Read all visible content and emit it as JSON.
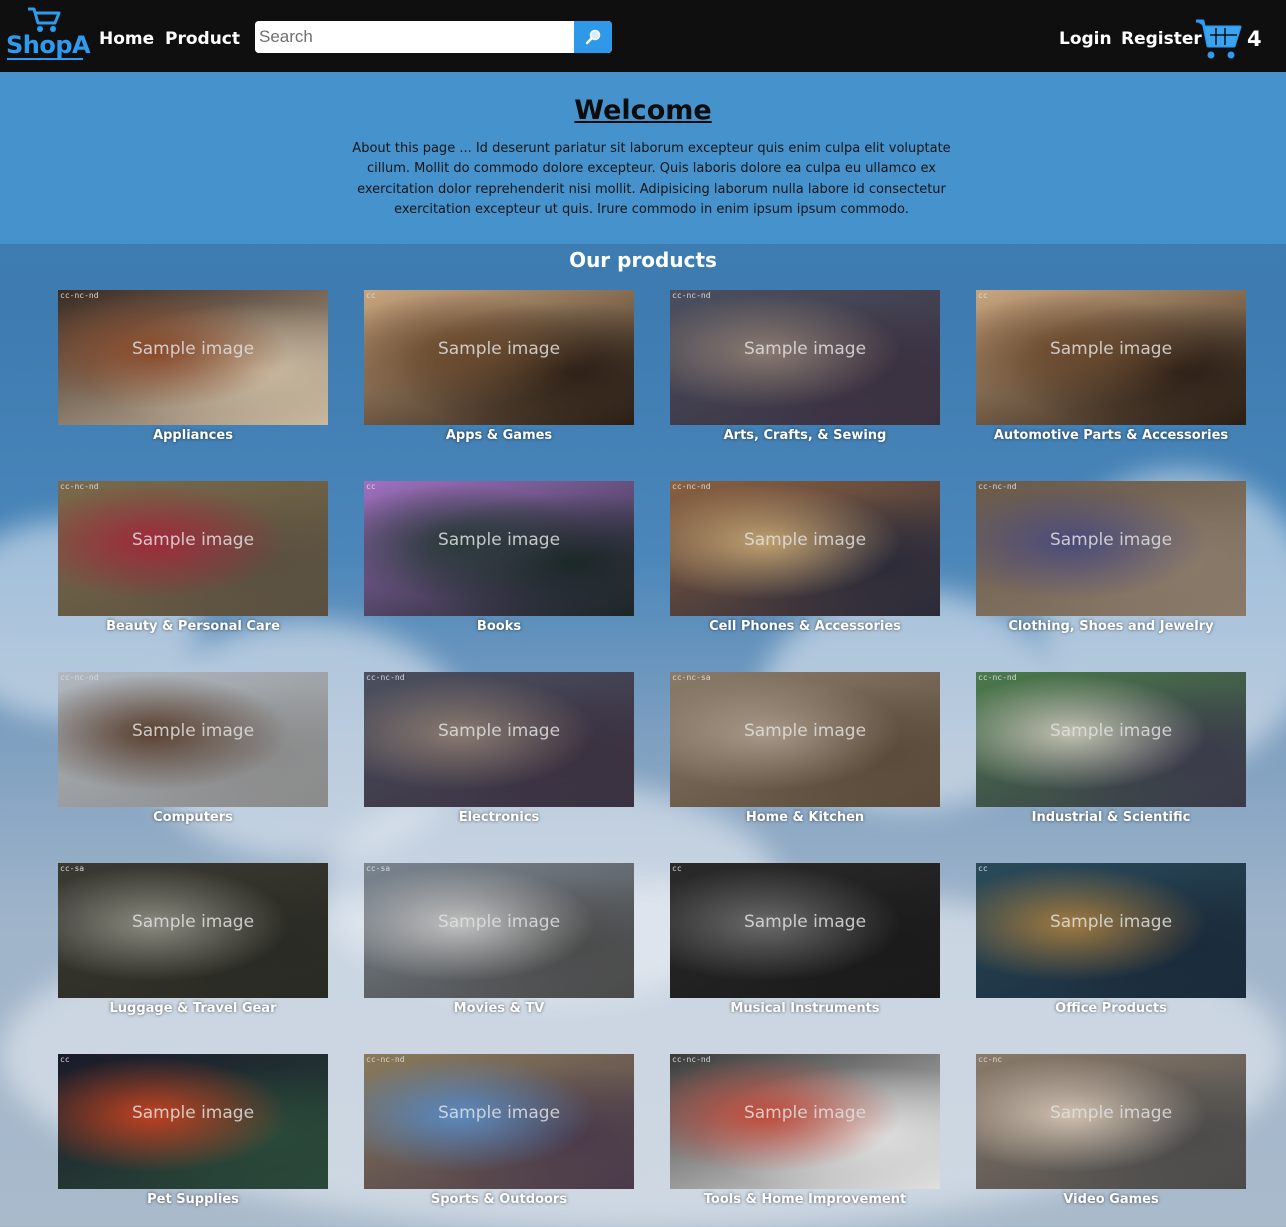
{
  "brand": {
    "name": "ShopA"
  },
  "nav": {
    "home": "Home",
    "product": "Product",
    "login": "Login",
    "register": "Register"
  },
  "search": {
    "placeholder": "Search",
    "value": ""
  },
  "cart": {
    "count": "4"
  },
  "hero": {
    "title": "Welcome",
    "text": "About this page ... Id deserunt pariatur sit laborum excepteur quis enim culpa elit voluptate cillum. Mollit do commodo dolore excepteur. Quis laboris dolore ea culpa eu ullamco ex exercitation dolor reprehenderit nisi mollit. Adipisicing laborum nulla labore id consectetur exercitation excepteur ut quis. Irure commodo in enim ipsum ipsum commodo."
  },
  "products": {
    "title": "Our products",
    "sample_text": "Sample image",
    "items": [
      {
        "label": "Appliances",
        "license": "cc-nc-nd",
        "colors": [
          "#3a2a22",
          "#8a4a2a",
          "#c9b9a0"
        ]
      },
      {
        "label": "Apps & Games",
        "license": "cc",
        "colors": [
          "#c9a680",
          "#6b4a2e",
          "#2a1e15"
        ]
      },
      {
        "label": "Arts, Crafts, & Sewing",
        "license": "cc-nc-nd",
        "colors": [
          "#4a4f5f",
          "#8a7a70",
          "#3a3040"
        ]
      },
      {
        "label": "Automotive Parts & Accessories",
        "license": "cc",
        "colors": [
          "#c9a680",
          "#6b4a2e",
          "#2a1e15"
        ]
      },
      {
        "label": "Beauty & Personal Care",
        "license": "cc-nc-nd",
        "colors": [
          "#7a6a4a",
          "#a02a3a",
          "#5a5040"
        ]
      },
      {
        "label": "Books",
        "license": "cc",
        "colors": [
          "#a070c0",
          "#2a3a3a",
          "#1a2626"
        ]
      },
      {
        "label": "Cell Phones & Accessories",
        "license": "cc-nc-nd",
        "colors": [
          "#8a6040",
          "#c0a070",
          "#2a2a3a"
        ]
      },
      {
        "label": "Clothing, Shoes and Jewelry",
        "license": "cc-nc-nd",
        "colors": [
          "#6a5a4a",
          "#4a4a7a",
          "#8a7a6a"
        ]
      },
      {
        "label": "Computers",
        "license": "cc-nc-nd",
        "colors": [
          "#b0b8c0",
          "#5a4030",
          "#8a8a8a"
        ]
      },
      {
        "label": "Electronics",
        "license": "cc-nc-nd",
        "colors": [
          "#4a4f5f",
          "#8a7a70",
          "#3a3040"
        ]
      },
      {
        "label": "Home & Kitchen",
        "license": "cc-nc-sa",
        "colors": [
          "#8a7a6a",
          "#a89888",
          "#5a4a3a"
        ]
      },
      {
        "label": "Industrial & Scientific",
        "license": "cc-nc-nd",
        "colors": [
          "#4a7a4a",
          "#c0c0b0",
          "#3a3a4a"
        ]
      },
      {
        "label": "Luggage & Travel Gear",
        "license": "cc-sa",
        "colors": [
          "#3a3a32",
          "#8a8a80",
          "#2a2a24"
        ]
      },
      {
        "label": "Movies & TV",
        "license": "cc-sa",
        "colors": [
          "#7a8590",
          "#c0c0c0",
          "#4a4a4a"
        ]
      },
      {
        "label": "Musical Instruments",
        "license": "cc",
        "colors": [
          "#2a2a2a",
          "#6a6a6a",
          "#1a1a1a"
        ]
      },
      {
        "label": "Office Products",
        "license": "cc",
        "colors": [
          "#2a4a5a",
          "#a07a40",
          "#1a2a3a"
        ]
      },
      {
        "label": "Pet Supplies",
        "license": "cc",
        "colors": [
          "#1a1a2a",
          "#c04020",
          "#2a4a3a"
        ]
      },
      {
        "label": "Sports & Outdoors",
        "license": "cc-nc-nd",
        "colors": [
          "#8a7a5a",
          "#5a8ac0",
          "#4a3a4a"
        ]
      },
      {
        "label": "Tools & Home Improvement",
        "license": "cc-nc-nd",
        "colors": [
          "#3a3a3a",
          "#c04a3a",
          "#e0e0e0"
        ]
      },
      {
        "label": "Video Games",
        "license": "cc-nc",
        "colors": [
          "#8a7a6a",
          "#d0c0b0",
          "#4a4a4a"
        ]
      }
    ]
  },
  "theme": {
    "navbar_bg": "#0f0f0f",
    "accent": "#2d9cf0",
    "hero_bg": "#4592cd"
  }
}
